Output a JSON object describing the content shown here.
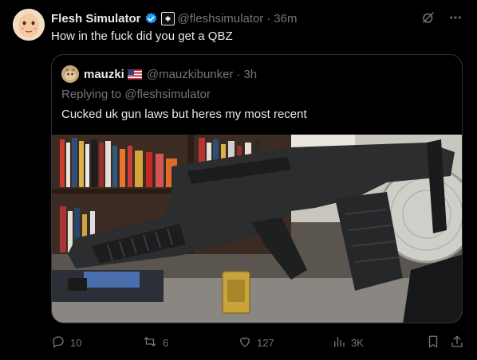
{
  "post": {
    "author_name": "Flesh Simulator",
    "handle": "@fleshsimulator",
    "time": "36m",
    "text": "How in the fuck did you get a QBZ"
  },
  "quoted": {
    "author_name": "mauzki",
    "handle": "@mauzkibunker",
    "time": "3h",
    "replying_to": "Replying to @fleshsimulator",
    "text": "Cucked uk gun laws but heres my most recent"
  },
  "actions": {
    "replies": "10",
    "reposts": "6",
    "likes": "127",
    "views": "3K"
  },
  "colors": {
    "background": "#000000",
    "text_primary": "#e7e9ea",
    "text_secondary": "#71767b",
    "verified_blue": "#1d9bf0",
    "border": "#2f3336"
  },
  "icons": [
    "verified-badge-icon",
    "affiliate-badge-icon",
    "grok-icon",
    "more-icon",
    "us-flag-icon",
    "reply-icon",
    "repost-icon",
    "like-icon",
    "views-icon",
    "bookmark-icon",
    "share-icon"
  ]
}
